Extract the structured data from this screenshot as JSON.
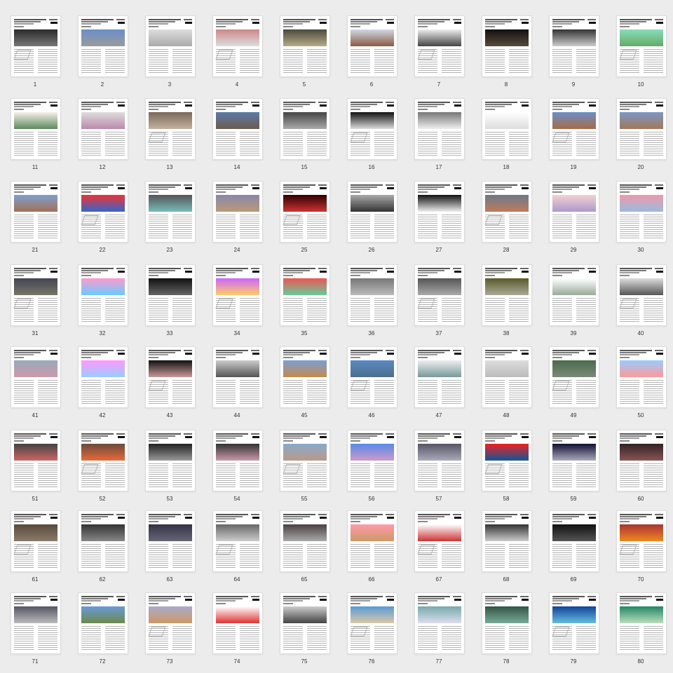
{
  "page_numbers": [
    "1",
    "2",
    "3",
    "4",
    "5",
    "6",
    "7",
    "8",
    "9",
    "10",
    "11",
    "12",
    "13",
    "14",
    "15",
    "16",
    "17",
    "18",
    "19",
    "20",
    "21",
    "22",
    "23",
    "24",
    "25",
    "26",
    "27",
    "28",
    "29",
    "30",
    "31",
    "32",
    "33",
    "34",
    "35",
    "36",
    "37",
    "38",
    "39",
    "40",
    "41",
    "42",
    "43",
    "44",
    "45",
    "46",
    "47",
    "48",
    "49",
    "50",
    "51",
    "52",
    "53",
    "54",
    "55",
    "56",
    "57",
    "58",
    "59",
    "60",
    "61",
    "62",
    "63",
    "64",
    "65",
    "66",
    "67",
    "68",
    "69",
    "70",
    "71",
    "72",
    "73",
    "74",
    "75",
    "76",
    "77",
    "78",
    "79",
    "80"
  ],
  "colors": {
    "background": "#ececec",
    "page": "#ffffff",
    "thumb_images": [
      "linear-gradient(#2b2b2b,#777)",
      "linear-gradient(#6a8fc9,#9b9b9b)",
      "linear-gradient(#ddd,#aaa)",
      "linear-gradient(#c88,#ddd)",
      "linear-gradient(#4a4a3e,#b7ab88)",
      "linear-gradient(#cfd8e5,#8a5b43)",
      "linear-gradient(#eee,#444)",
      "linear-gradient(#111,#5a4a3a)",
      "linear-gradient(#333,#ccc)",
      "linear-gradient(#8db,#6a6)",
      "linear-gradient(#f4f0e8,#5c8a5c)",
      "linear-gradient(#ddd,#b8a)",
      "linear-gradient(#7a6a5a,#c3b29d)",
      "linear-gradient(#5a7aa8,#6e5b4c)",
      "linear-gradient(#444,#aaa)",
      "linear-gradient(#111,#ddd)",
      "linear-gradient(#777,#eee)",
      "linear-gradient(#fff,#ddd)",
      "linear-gradient(#6b8fc9,#a86b45)",
      "linear-gradient(#7b98c4,#a3785a)",
      "linear-gradient(#7ea0d0,#a37055)",
      "linear-gradient(#e33,#36c)",
      "linear-gradient(#555,#7bb)",
      "linear-gradient(#88a,#b97)",
      "linear-gradient(#300,#c33)",
      "linear-gradient(#aaa,#333)",
      "linear-gradient(#111,#eee)",
      "linear-gradient(#6a7a8a,#c07a5a)",
      "linear-gradient(#f5d0d0,#a9c)",
      "linear-gradient(#e9a,#9bd)",
      "linear-gradient(#445,#776)",
      "linear-gradient(#f9c,#6cf)",
      "linear-gradient(#111,#666)",
      "linear-gradient(#c6f,#fc6)",
      "linear-gradient(#e55,#6c9)",
      "linear-gradient(#777,#bbb)",
      "linear-gradient(#555,#aaa)",
      "linear-gradient(#5a5a2a,#aa9)",
      "linear-gradient(#fff,#9a9)",
      "linear-gradient(#ddd,#555)",
      "linear-gradient(#9ab,#c9a)",
      "linear-gradient(#f9f,#9cf)",
      "linear-gradient(#111,#c99)",
      "linear-gradient(#ccc,#555)",
      "linear-gradient(#7a9fd6,#c68a4a)",
      "linear-gradient(#5a8ac5,#4d6d8a)",
      "linear-gradient(#eee,#799)",
      "linear-gradient(#ddd,#bbb)",
      "linear-gradient(#4a6a4a,#7a8a7a)",
      "linear-gradient(#9cf,#f99)",
      "linear-gradient(#444,#c66)",
      "linear-gradient(#6a4a3a,#e96a3a)",
      "linear-gradient(#222,#999)",
      "linear-gradient(#333,#c9a)",
      "linear-gradient(#8ac,#b98)",
      "linear-gradient(#5a8ae6,#c9c)",
      "linear-gradient(#556,#aab)",
      "linear-gradient(#e22,#159)",
      "linear-gradient(#113,#aab)",
      "linear-gradient(#322,#855)",
      "linear-gradient(#5a4a3a,#8a7a6a)",
      "linear-gradient(#333,#888)",
      "linear-gradient(#334,#667)",
      "linear-gradient(#666,#ccc)",
      "linear-gradient(#4a4040,#aaa)",
      "linear-gradient(#f9a,#c96)",
      "linear-gradient(#fff,#c33)",
      "linear-gradient(#333,#ccc)",
      "linear-gradient(#111,#555)",
      "linear-gradient(#a33,#e82)",
      "linear-gradient(#556,#bbb)",
      "linear-gradient(#6a9ad6,#6a8a4a)",
      "linear-gradient(#aac,#c96)",
      "linear-gradient(#fff,#d33)",
      "linear-gradient(#ccc,#444)",
      "linear-gradient(#5a9ad6,#d9c9a9)",
      "linear-gradient(#7aa,#dde)",
      "linear-gradient(#354,#7a9)",
      "linear-gradient(#149,#6bd)",
      "linear-gradient(#286,#bdb)"
    ]
  }
}
